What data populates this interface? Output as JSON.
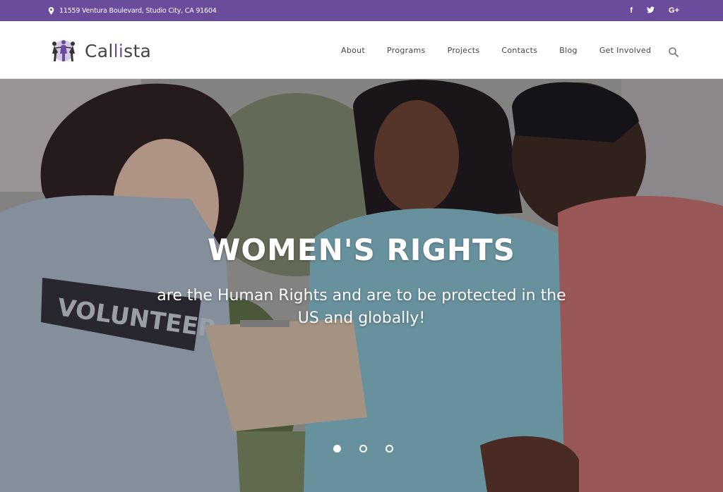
{
  "topbar": {
    "address": "11559 Ventura Boulevard, Studio City, CA 91604",
    "social": [
      {
        "icon": "facebook-icon",
        "label": "f"
      },
      {
        "icon": "twitter-icon",
        "label": "t"
      },
      {
        "icon": "google-plus-icon",
        "label": "G+"
      }
    ],
    "bg_color": "#6a4b9c"
  },
  "header": {
    "logo_text_start": "Cal",
    "logo_text_accent": "li",
    "logo_text_end": "sta",
    "nav": [
      "About",
      "Programs",
      "Projects",
      "Contacts",
      "Blog",
      "Get Involved"
    ]
  },
  "hero": {
    "title": "WOMEN'S RIGHTS",
    "subtitle": "are the Human Rights and are to be protected in the US and globally!",
    "slides": 3,
    "active_slide": 1
  }
}
